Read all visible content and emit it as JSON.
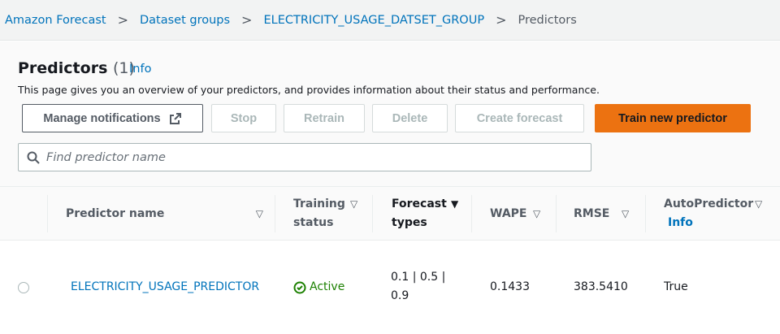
{
  "breadcrumb": [
    "Amazon Forecast",
    "Dataset groups",
    "ELECTRICITY_USAGE_DATSET_GROUP",
    "Predictors"
  ],
  "header": {
    "title": "Predictors",
    "count": "(1)",
    "info": "Info",
    "description": "This page gives you an overview of your predictors, and provides information about their status and performance."
  },
  "buttons": {
    "manage": "Manage notifications",
    "stop": "Stop",
    "retrain": "Retrain",
    "delete": "Delete",
    "create_forecast": "Create forecast",
    "train": "Train new predictor"
  },
  "search": {
    "placeholder": "Find predictor name"
  },
  "table": {
    "columns": {
      "name": "Predictor name",
      "status_1": "Training",
      "status_2": "status",
      "types_1": "Forecast",
      "types_2": "types",
      "wape": "WAPE",
      "rmse": "RMSE",
      "auto": "AutoPredictor",
      "auto_info": "Info"
    },
    "rows": [
      {
        "name": "ELECTRICITY_USAGE_PREDICTOR",
        "status": "Active",
        "types_1": "0.1 | 0.5 |",
        "types_2": "0.9",
        "wape": "0.1433",
        "rmse": "383.5410",
        "auto": "True"
      }
    ]
  },
  "colors": {
    "accent": "#ec7211",
    "link": "#0073bb",
    "success": "#1d8102"
  }
}
